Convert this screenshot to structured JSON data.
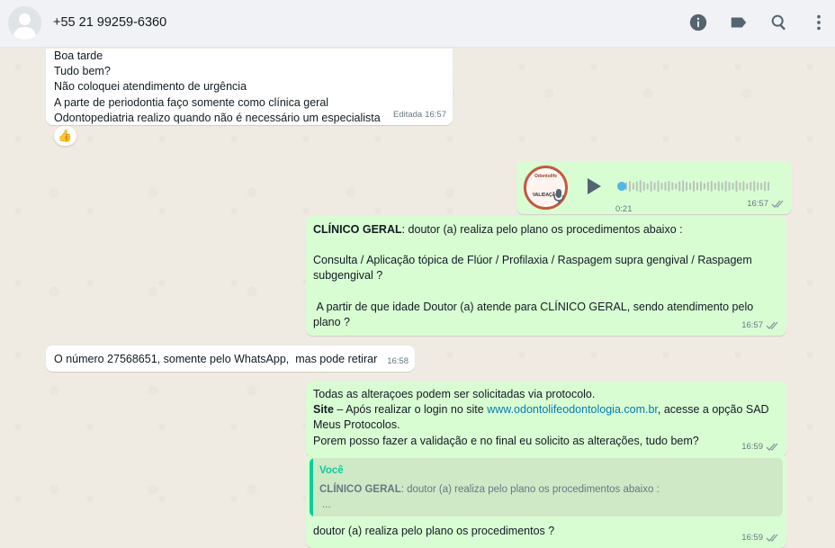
{
  "header": {
    "contact_name": "+55 21 99259-6360",
    "icons": [
      "info-icon",
      "label-icon",
      "search-icon",
      "menu-icon"
    ]
  },
  "messages": {
    "m1": {
      "lines": [
        "Boa tarde",
        "Tudo bem?",
        "Não coloquei atendimento de urgência",
        "A parte  de periodontia faço somente como clínica geral",
        "Odontopediatria realizo quando não é necessário um especialista"
      ],
      "edited_label": "Editada",
      "time": "16:57",
      "reaction": "👍"
    },
    "voice": {
      "avatar_text_top": "Odontolife",
      "avatar_text_mid": "VALIDAÇÃO",
      "duration": "0:21",
      "time": "16:57",
      "progress": 0
    },
    "m3": {
      "title": "CLÍNICO GERAL",
      "line1": ":  doutor (a) realiza pelo plano os procedimentos abaixo :",
      "line2": "Consulta /  Aplicação tópica de Flúor  /  Profilaxia / Raspagem supra gengival / Raspagem subgengival ?",
      "line3": " A partir de que idade Doutor (a) atende para CLÍNICO GERAL, sendo atendimento pelo plano ?",
      "time": "16:57"
    },
    "m4": {
      "text": "O número 27568651, somente pelo WhatsApp,  mas pode retirar",
      "time": "16:58"
    },
    "m5": {
      "line1": "Todas as alteraçoes podem ser solicitadas via protocolo.",
      "site_label": "Site",
      "line2_a": " – Após realizar o login no site ",
      "link": "www.odontolifeodontologia.com.br",
      "line2_b": ", acesse a opção SAD",
      "line3": "Meus Protocolos.",
      "line4": "Porem posso fazer a validação e no final eu solicito as alterações, tudo bem?",
      "time": "16:59"
    },
    "m6": {
      "quote_author": "Você",
      "quote_title": "CLÍNICO GERAL",
      "quote_rest": ":  doutor (a) realiza pelo plano os procedimentos abaixo :",
      "quote_more": "...",
      "text": "doutor (a) realiza pelo plano os procedimentos ?",
      "time": "16:59"
    }
  },
  "colors": {
    "outgoing": "#d9fdd3",
    "incoming": "#ffffff",
    "accent": "#06cf9c",
    "link": "#027eb5",
    "header_bg": "#f0f2f5"
  }
}
